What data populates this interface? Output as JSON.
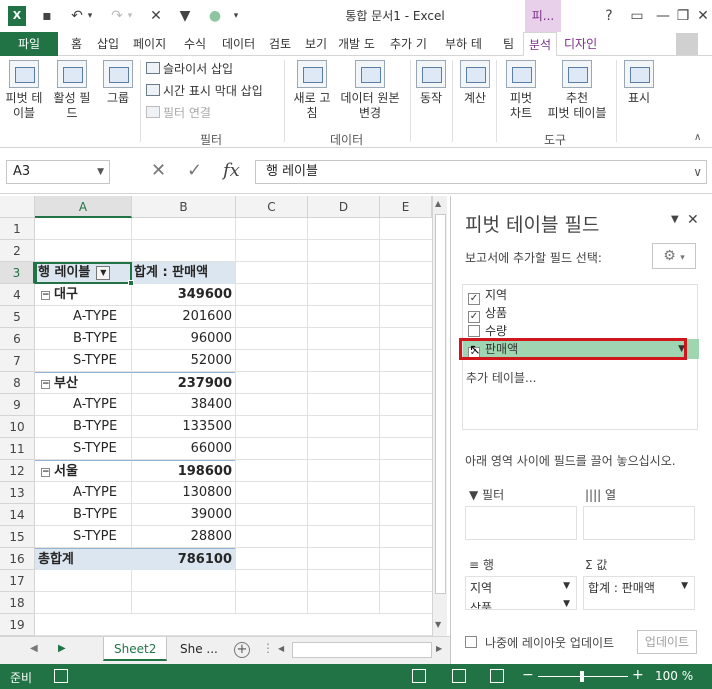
{
  "title_bar": {
    "title": "통합 문서1 - Excel",
    "context_tab": "피...",
    "buttons": [
      "?",
      "▭",
      "—",
      "▭",
      "✕"
    ]
  },
  "ribbon_tabs": {
    "file": "파일",
    "tabs": [
      "홈",
      "삽입",
      "페이지",
      "수식",
      "데이터",
      "검토",
      "보기",
      "개발 도",
      "추가 기",
      "부하 테",
      "팀"
    ],
    "active": "분석",
    "design": "디자인"
  },
  "ribbon": {
    "pivot_table": "피벗 테\n이블",
    "active_field": "활성 필\n드",
    "group": "그룹",
    "slicer": "슬라이서 삽입",
    "timeline": "시간 표시 막대 삽입",
    "filter_conn": "필터 연결",
    "filter_group": "필터",
    "refresh": "새로 고\n침",
    "change_source": "데이터 원본\n변경",
    "data_group": "데이터",
    "actions": "동작",
    "calc": "계산",
    "pivot_chart": "피벗\n차트",
    "recommended": "추천\n피벗 테이블",
    "tools_group": "도구",
    "show": "표시"
  },
  "formula_bar": {
    "name_box": "A3",
    "formula": "행 레이블"
  },
  "sheet": {
    "columns": [
      "A",
      "B",
      "C",
      "D",
      "E"
    ],
    "rows": [
      "1",
      "2",
      "3",
      "4",
      "5",
      "6",
      "7",
      "8",
      "9",
      "10",
      "11",
      "12",
      "13",
      "14",
      "15",
      "16",
      "17",
      "18",
      "19"
    ],
    "pivot": {
      "row_label_header": "행 레이블",
      "value_header": "합계 : 판매액",
      "groups": [
        {
          "name": "대구",
          "total": "349600",
          "items": [
            {
              "label": "A-TYPE",
              "value": "201600"
            },
            {
              "label": "B-TYPE",
              "value": "96000"
            },
            {
              "label": "S-TYPE",
              "value": "52000"
            }
          ]
        },
        {
          "name": "부산",
          "total": "237900",
          "items": [
            {
              "label": "A-TYPE",
              "value": "38400"
            },
            {
              "label": "B-TYPE",
              "value": "133500"
            },
            {
              "label": "S-TYPE",
              "value": "66000"
            }
          ]
        },
        {
          "name": "서울",
          "total": "198600",
          "items": [
            {
              "label": "A-TYPE",
              "value": "130800"
            },
            {
              "label": "B-TYPE",
              "value": "39000"
            },
            {
              "label": "S-TYPE",
              "value": "28800"
            }
          ]
        }
      ],
      "grand_total_label": "총합계",
      "grand_total": "786100"
    }
  },
  "sheet_tabs": {
    "active": "Sheet2",
    "other": "She ..."
  },
  "status": {
    "ready": "준비",
    "zoom": "100 %"
  },
  "pane": {
    "title": "피벗 테이블 필드",
    "choose_label": "보고서에 추가할 필드 선택:",
    "fields": [
      {
        "name": "지역",
        "checked": true
      },
      {
        "name": "상품",
        "checked": true
      },
      {
        "name": "수량",
        "checked": false
      },
      {
        "name": "판매액",
        "checked": true
      }
    ],
    "more_tables": "추가 테이블...",
    "drag_label": "아래 영역 사이에 필드를 끌어 놓으십시오.",
    "areas": {
      "filter": "필터",
      "columns": "열",
      "rows": "행",
      "values": "값",
      "rows_items": [
        "지역",
        "상품"
      ],
      "values_items": [
        "합계 : 판매액"
      ]
    },
    "defer_label": "나중에 레이아웃 업데이트",
    "update_button": "업데이트"
  }
}
